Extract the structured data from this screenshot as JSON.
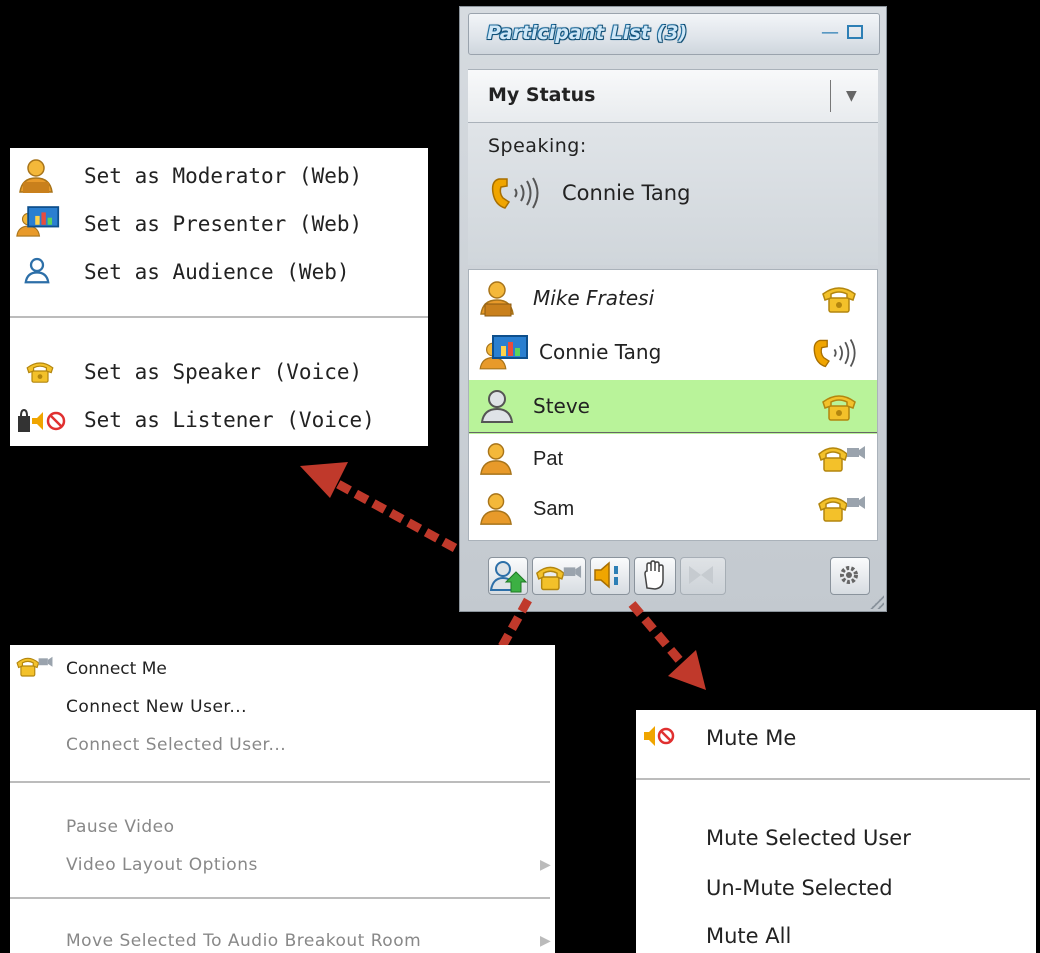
{
  "panel": {
    "title": "Participant List (3)",
    "my_status_label": "My Status",
    "speaking_label": "Speaking:",
    "speaking_name": "Connie Tang",
    "participants": [
      {
        "name": "Mike Fratesi",
        "role": "moderator",
        "voice": "speaker"
      },
      {
        "name": "Connie Tang",
        "role": "presenter",
        "voice": "talking"
      },
      {
        "name": "Steve",
        "role": "audience",
        "voice": "speaker",
        "highlighted": true
      },
      {
        "name": "Pat",
        "role": "participant",
        "voice": "video"
      },
      {
        "name": "Sam",
        "role": "participant",
        "voice": "video"
      }
    ]
  },
  "role_menu": {
    "items": [
      {
        "label": "Set as Moderator (Web)",
        "icon": "moderator-icon"
      },
      {
        "label": "Set as Presenter (Web)",
        "icon": "presenter-icon"
      },
      {
        "label": "Set as Audience (Web)",
        "icon": "audience-icon"
      },
      {
        "label": "Set as Speaker (Voice)",
        "icon": "speaker-phone-icon"
      },
      {
        "label": "Set as Listener (Voice)",
        "icon": "listener-icon"
      }
    ]
  },
  "video_menu": {
    "items": [
      {
        "label": "Connect Me",
        "enabled": true
      },
      {
        "label": "Connect New User...",
        "enabled": true
      },
      {
        "label": "Connect Selected User...",
        "enabled": false
      },
      {
        "label": "Pause Video",
        "enabled": false
      },
      {
        "label": "Video Layout Options",
        "enabled": false,
        "submenu": true
      },
      {
        "label": "Move Selected To Audio Breakout Room",
        "enabled": false,
        "submenu": true
      }
    ]
  },
  "mute_menu": {
    "items": [
      {
        "label": "Mute Me"
      },
      {
        "label": "Mute Selected User"
      },
      {
        "label": "Un-Mute Selected"
      },
      {
        "label": "Mute All"
      }
    ]
  },
  "colors": {
    "arrow": "#c0392b",
    "highlight_row": "#b9f39a",
    "phone": "#f0a500",
    "title_blue": "#2d7fb5"
  }
}
